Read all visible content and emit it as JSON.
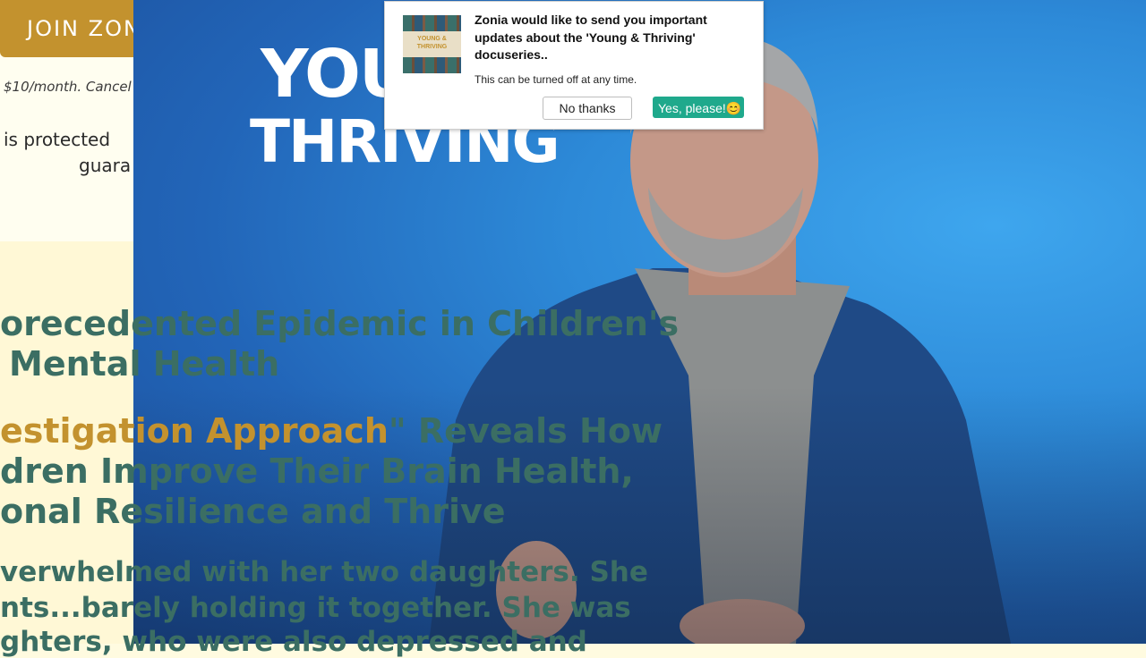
{
  "page": {
    "join_button": "JOIN ZON",
    "price_note": "$10/month. Cancel",
    "protected_text": "is protected",
    "guarantee_fragment": "guara"
  },
  "video": {
    "logo_line1": "YOU",
    "logo_line2": "THRIVING"
  },
  "headline": {
    "line1": "orecedented Epidemic in Children's",
    "line2": "Mental Health",
    "line3_gold": "estigation Approach",
    "line3_rest": "\" Reveals How",
    "line4": "dren Improve Their Brain Health,",
    "line5": "onal Resilience and Thrive"
  },
  "body_text": {
    "line1": "verwhelmed with her two daughters. She",
    "line2": "nts...barely holding it together. She was",
    "line3": "ghters, who were also depressed and"
  },
  "notification": {
    "title": "Zonia would like to send you important updates about the 'Young & Thriving' docuseries..",
    "subtitle": "This can be turned off at any time.",
    "thumb_label": "YOUNG & THRIVING",
    "no_button": "No thanks",
    "yes_button": "Yes, please!😊",
    "accent_color": "#1fa98c"
  },
  "colors": {
    "brand_gold": "#c3922e",
    "headline_teal": "#3b6e63",
    "page_cream": "#fff8d6"
  }
}
